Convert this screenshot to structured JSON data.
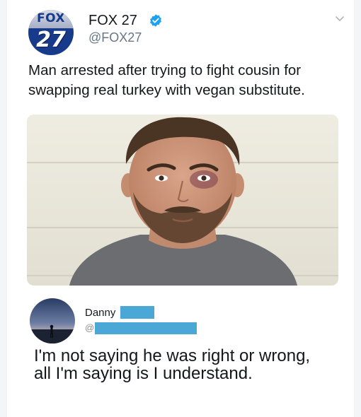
{
  "tweet": {
    "account_name": "FOX 27",
    "handle": "@FOX27",
    "logo": {
      "top": "FOX",
      "number": "27"
    },
    "text": "Man arrested after trying to fight cousin for swapping real turkey with vegan substitute.",
    "verified_icon": "verified-badge-icon",
    "more_icon": "chevron-down-icon",
    "colors": {
      "verified": "#1da1f2",
      "logo_blue": "#173a8a"
    }
  },
  "reply": {
    "name": "Danny",
    "handle_prefix": "@",
    "text": "I'm not saying he was right or wrong, all I'm saying is I understand.",
    "redaction_color": "#4ba8d6"
  }
}
